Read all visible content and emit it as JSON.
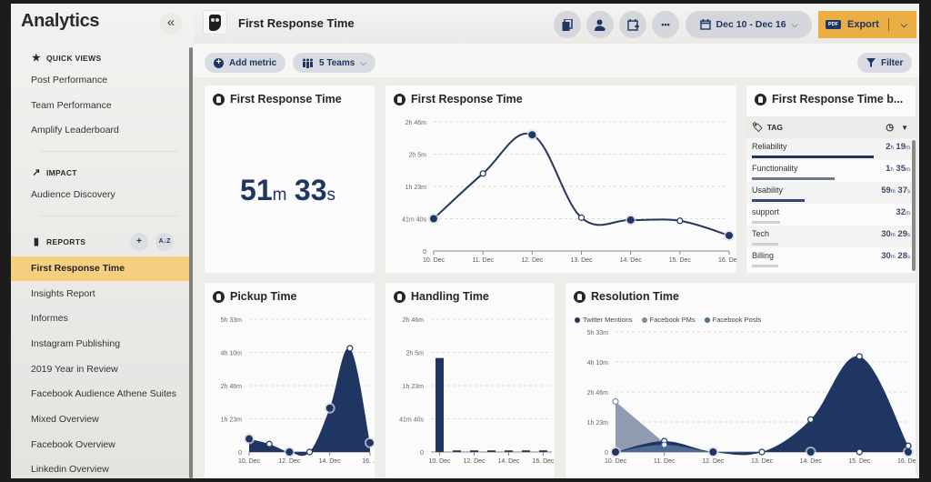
{
  "sidebar": {
    "title": "Analytics",
    "collapse_icon": "double-chevron-left",
    "sections": {
      "quick_views": {
        "label": "QUICK VIEWS",
        "icon": "star",
        "items": [
          "Post Performance",
          "Team Performance",
          "Amplify Leaderboard"
        ]
      },
      "impact": {
        "label": "IMPACT",
        "icon": "trend-arrow",
        "items": [
          "Audience Discovery"
        ]
      },
      "reports": {
        "label": "REPORTS",
        "icon": "bar-chart",
        "add_icon": "+",
        "sort_icon": "A↓Z",
        "items": [
          "First Response Time",
          "Insights Report",
          "Informes",
          "Instagram Publishing",
          "2019 Year in Review",
          "Facebook Audience Athene Suites",
          "Mixed Overview",
          "Facebook Overview",
          "Linkedin Overview"
        ],
        "active": "First Response Time"
      }
    }
  },
  "header": {
    "title": "First Response Time",
    "actions": [
      "duplicate",
      "add-user",
      "schedule",
      "more"
    ],
    "more_label": "•••",
    "date_range": "Dec 10 - Dec 16",
    "export": {
      "badge": "PDF",
      "label": "Export"
    }
  },
  "toolbar": {
    "add_metric": "Add metric",
    "teams": "5 Teams",
    "filter": "Filter"
  },
  "colors": {
    "accent": "#1f3562",
    "export": "#eaae45",
    "active_item": "#f5cf7f",
    "fb_pms": "#7e8aa3",
    "fb_posts": "#4e6b96"
  },
  "cards": {
    "summary": {
      "title": "First Response Time",
      "minutes": "51",
      "minutes_unit": "m",
      "seconds": "33",
      "seconds_unit": "s"
    },
    "by_tag": {
      "title": "First Response Time b...",
      "header": "TAG",
      "rows": [
        {
          "name": "Reliability",
          "value_a": "2",
          "unit_a": "h",
          "value_b": "19",
          "unit_b": "m",
          "share": 1.0,
          "color": "#1f3562"
        },
        {
          "name": "Functionality",
          "value_a": "1",
          "unit_a": "h",
          "value_b": "35",
          "unit_b": "m",
          "share": 0.68,
          "color": "#6e7890"
        },
        {
          "name": "Usability",
          "value_a": "59",
          "unit_a": "m",
          "value_b": "37",
          "unit_b": "s",
          "share": 0.43,
          "color": "#2f4a7a"
        },
        {
          "name": "support",
          "value_a": "32",
          "unit_a": "m",
          "value_b": "",
          "unit_b": "",
          "share": 0.23,
          "color": "#cfd0d4"
        },
        {
          "name": "Tech",
          "value_a": "30",
          "unit_a": "m",
          "value_b": "29",
          "unit_b": "s",
          "share": 0.22,
          "color": "#cfd0d4"
        },
        {
          "name": "Billing",
          "value_a": "30",
          "unit_a": "m",
          "value_b": "28",
          "unit_b": "s",
          "share": 0.22,
          "color": "#cfd0d4"
        }
      ]
    }
  },
  "chart_data": [
    {
      "id": "first_response_line",
      "type": "line",
      "title": "First Response Time",
      "x": [
        "10. Dec",
        "11. Dec",
        "12. Dec",
        "13. Dec",
        "14. Dec",
        "15. Dec",
        "16. Dec"
      ],
      "y_ticks": [
        "0",
        "41m 40s",
        "1h 23m",
        "2h 5m",
        "2h 46m"
      ],
      "ylim_minutes": [
        0,
        166.7
      ],
      "values_minutes": [
        41.7,
        100,
        150,
        43,
        40,
        39,
        20
      ],
      "markers": [
        "filled",
        "hollow",
        "filled",
        "hollow",
        "filled",
        "hollow",
        "filled"
      ],
      "grid": true
    },
    {
      "id": "pickup_area",
      "type": "area",
      "title": "Pickup Time",
      "x": [
        "10. Dec",
        "11. Dec",
        "12. Dec",
        "13. Dec",
        "14. Dec",
        "15. Dec",
        "16. Dec"
      ],
      "x_tick_labels": [
        "10. Dec",
        "12. Dec",
        "14. Dec",
        "16. ..."
      ],
      "y_ticks": [
        "0",
        "1h 23m",
        "2h 46m",
        "4h 10m",
        "5h 33m"
      ],
      "ylim_minutes": [
        0,
        333
      ],
      "values_minutes": [
        33,
        20,
        0,
        0,
        110,
        260,
        23
      ],
      "markers": [
        "filled",
        "hollow",
        "filled",
        "hollow",
        "filled",
        "hollow",
        "filled"
      ],
      "grid": true
    },
    {
      "id": "handling_bar",
      "type": "bar",
      "title": "Handling Time",
      "categories": [
        "10. Dec",
        "11. Dec",
        "12. Dec",
        "13. Dec",
        "14. Dec",
        "15. Dec",
        "16. Dec"
      ],
      "x_tick_labels": [
        "10. Dec",
        "12. Dec",
        "14. Dec",
        "16. Dec"
      ],
      "y_ticks": [
        "0",
        "41m 40s",
        "1h 23m",
        "2h 5m",
        "2h 46m"
      ],
      "ylim_minutes": [
        0,
        166.7
      ],
      "values_minutes": [
        118,
        2,
        2,
        2,
        2,
        2,
        2
      ],
      "grid": true
    },
    {
      "id": "resolution_area",
      "type": "area",
      "title": "Resolution Time",
      "x": [
        "10. Dec",
        "11. Dec",
        "12. Dec",
        "13. Dec",
        "14. Dec",
        "15. Dec",
        "16. Dec"
      ],
      "y_ticks": [
        "0",
        "1h 23m",
        "2h 46m",
        "4h 10m",
        "5h 33m"
      ],
      "ylim_minutes": [
        0,
        333
      ],
      "legend": [
        "Twitter Mentions",
        "Facebook PMs",
        "Facebook Posts"
      ],
      "legend_position": "top-left",
      "series": [
        {
          "name": "Twitter Mentions",
          "color": "#1f3562",
          "values_minutes": [
            0,
            30,
            0,
            0,
            90,
            265,
            17
          ]
        },
        {
          "name": "Facebook PMs",
          "color": "#7e8aa3",
          "values_minutes": [
            140,
            25,
            0,
            0,
            0,
            0,
            0
          ]
        },
        {
          "name": "Facebook Posts",
          "color": "#4e6b96",
          "values_minutes": [
            0,
            20,
            0,
            0,
            0,
            0,
            0
          ]
        }
      ],
      "grid": true
    }
  ]
}
